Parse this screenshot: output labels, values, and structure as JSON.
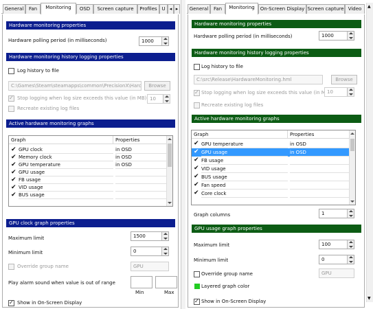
{
  "left": {
    "tabs": [
      "General",
      "Fan",
      "Monitoring",
      "OSD",
      "Screen capture",
      "Profiles",
      "U"
    ],
    "hw_props_header": "Hardware monitoring properties",
    "polling_label": "Hardware polling period (in milliseconds)",
    "polling_value": "1000",
    "history_header": "Hardware monitoring history logging properties",
    "log_history_label": "Log history to file",
    "log_path": "C:\\Games\\Steam\\steamapps\\common\\PrecisionX\\HardwareMonitoring.hml",
    "browse_label": "Browse",
    "stop_logging_label": "Stop logging when log size exceeds this value (in MB)",
    "stop_logging_value": "10",
    "recreate_label": "Recreate existing log files",
    "graphs_header": "Active hardware monitoring graphs",
    "col_graph": "Graph",
    "col_properties": "Properties",
    "graphs": [
      {
        "name": "GPU clock",
        "prop": "in OSD",
        "checked": true
      },
      {
        "name": "Memory clock",
        "prop": "in OSD",
        "checked": true
      },
      {
        "name": "GPU temperature",
        "prop": "in OSD",
        "checked": true
      },
      {
        "name": "GPU usage",
        "prop": "",
        "checked": true
      },
      {
        "name": "FB usage",
        "prop": "",
        "checked": true
      },
      {
        "name": "VID usage",
        "prop": "",
        "checked": true
      },
      {
        "name": "BUS usage",
        "prop": "",
        "checked": true
      }
    ],
    "graph_props_header": "GPU clock graph properties",
    "max_label": "Maximum limit",
    "max_value": "1500",
    "min_label": "Minimum limit",
    "min_value": "0",
    "override_label": "Override group name",
    "group_name": "GPU",
    "alarm_label": "Play alarm sound when value is out of range",
    "min_caption": "Min",
    "max_caption": "Max",
    "show_osd_label": "Show in On-Screen Display"
  },
  "right": {
    "tabs": [
      "General",
      "Fan",
      "Monitoring",
      "On-Screen Display",
      "Screen capture",
      "Video"
    ],
    "hw_props_header": "Hardware monitoring properties",
    "polling_label": "Hardware polling period (in milliseconds)",
    "polling_value": "1000",
    "history_header": "Hardware monitoring history logging properties",
    "log_history_label": "Log history to file",
    "log_path": "C:\\src\\Release\\HardwareMonitoring.hml",
    "browse_label": "Browse",
    "stop_logging_label": "Stop logging when log size exceeds this value (in MB)",
    "stop_logging_value": "10",
    "recreate_label": "Recreate existing log files",
    "graphs_header": "Active hardware monitoring graphs",
    "col_graph": "Graph",
    "col_properties": "Properties",
    "graphs": [
      {
        "name": "GPU temperature",
        "prop": "in OSD",
        "checked": true
      },
      {
        "name": "GPU usage",
        "prop": "in OSD",
        "checked": true
      },
      {
        "name": "FB usage",
        "prop": "",
        "checked": true
      },
      {
        "name": "VID usage",
        "prop": "",
        "checked": true
      },
      {
        "name": "BUS usage",
        "prop": "",
        "checked": true
      },
      {
        "name": "Fan speed",
        "prop": "",
        "checked": true
      },
      {
        "name": "Core clock",
        "prop": "",
        "checked": true
      }
    ],
    "graph_columns_label": "Graph columns",
    "graph_columns_value": "1",
    "graph_props_header": "GPU usage graph properties",
    "max_label": "Maximum limit",
    "max_value": "100",
    "min_label": "Minimum limit",
    "min_value": "0",
    "override_label": "Override group name",
    "group_name": "GPU",
    "layered_color_label": "Layered graph color",
    "layered_color": "#22cc22",
    "show_osd_label": "Show in On-Screen Display"
  }
}
